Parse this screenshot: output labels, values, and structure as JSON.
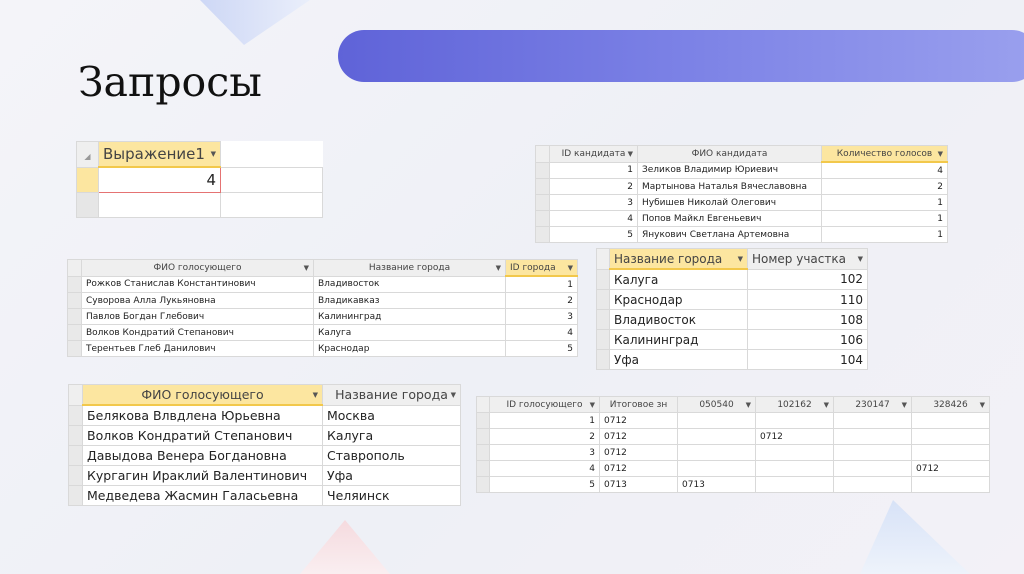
{
  "slide": {
    "title": "Запросы"
  },
  "table1": {
    "header": "Выражение1",
    "rows": [
      "4",
      ""
    ]
  },
  "table2": {
    "headers": [
      "ID кандидата",
      "ФИО кандидата",
      "Количество голосов"
    ],
    "rows": [
      [
        "1",
        "Зеликов Владимир Юриевич",
        "4"
      ],
      [
        "2",
        "Мартынова Наталья Вячеславовна",
        "2"
      ],
      [
        "3",
        "Нубишев Николай Олегович",
        "1"
      ],
      [
        "4",
        "Попов Майкл Евгеньевич",
        "1"
      ],
      [
        "5",
        "Янукович Светлана Артемовна",
        "1"
      ]
    ]
  },
  "table3": {
    "headers": [
      "ФИО голосующего",
      "Название города",
      "ID города"
    ],
    "rows": [
      [
        "Рожков Станислав Константинович",
        "Владивосток",
        "1"
      ],
      [
        "Суворова Алла Лукьяновна",
        "Владикавказ",
        "2"
      ],
      [
        "Павлов Богдан Глебович",
        "Калининград",
        "3"
      ],
      [
        "Волков Кондратий Степанович",
        "Калуга",
        "4"
      ],
      [
        "Терентьев Глеб Данилович",
        "Краснодар",
        "5"
      ]
    ]
  },
  "table4": {
    "headers": [
      "Название города",
      "Номер участка"
    ],
    "rows": [
      [
        "Калуга",
        "102"
      ],
      [
        "Краснодар",
        "110"
      ],
      [
        "Владивосток",
        "108"
      ],
      [
        "Калининград",
        "106"
      ],
      [
        "Уфа",
        "104"
      ]
    ]
  },
  "table5": {
    "headers": [
      "ФИО голосующего",
      "Название города"
    ],
    "rows": [
      [
        "Белякова Влвдлена Юрьевна",
        "Москва"
      ],
      [
        "Волков Кондратий Степанович",
        "Калуга"
      ],
      [
        "Давыдова Венера Богдановна",
        "Ставрополь"
      ],
      [
        "Кургагин Ираклий Валентинович",
        "Уфа"
      ],
      [
        "Медведева Жасмин Галасьевна",
        "Челяинск"
      ]
    ]
  },
  "table6": {
    "headers": [
      "ID голосующего",
      "Итоговое зн",
      "050540",
      "102162",
      "230147",
      "328426"
    ],
    "rows": [
      [
        "1",
        "0712",
        "",
        "",
        "",
        ""
      ],
      [
        "2",
        "0712",
        "",
        "0712",
        "",
        ""
      ],
      [
        "3",
        "0712",
        "",
        "",
        "",
        ""
      ],
      [
        "4",
        "0712",
        "",
        "",
        "",
        "0712"
      ],
      [
        "5",
        "0713",
        "0713",
        "",
        "",
        ""
      ]
    ]
  }
}
